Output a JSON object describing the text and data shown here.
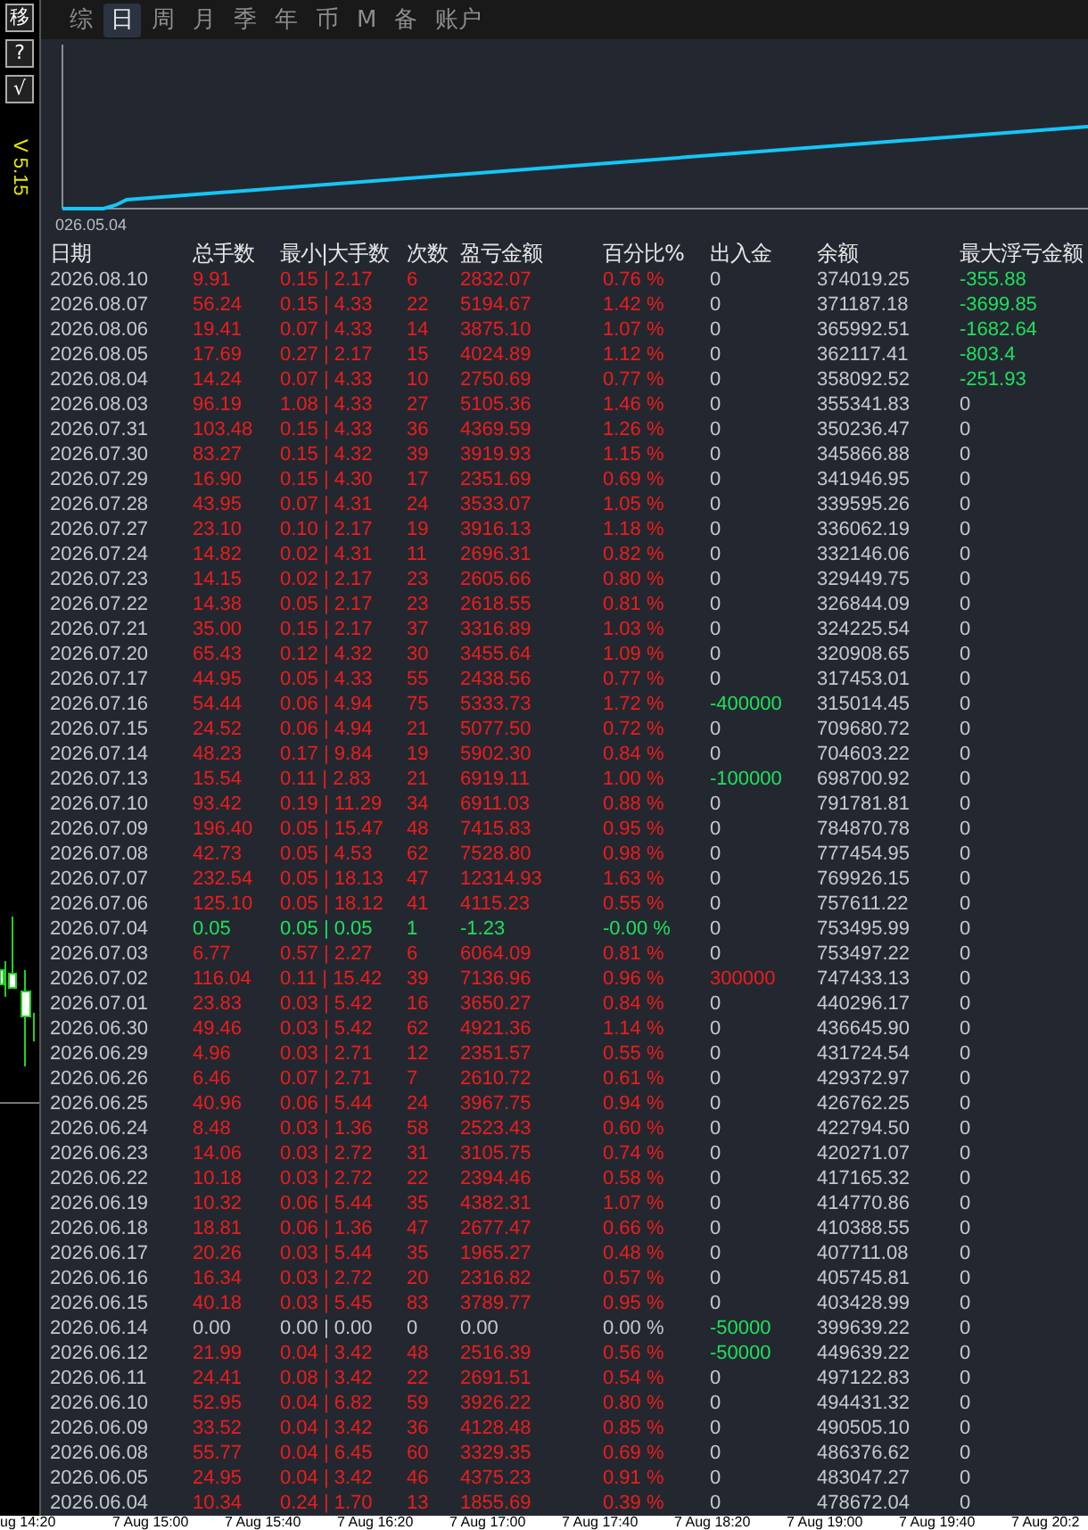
{
  "side_buttons": [
    "移",
    "?",
    "√"
  ],
  "version": "V 5.15",
  "tabs": [
    {
      "label": "综",
      "selected": false
    },
    {
      "label": "日",
      "selected": true
    },
    {
      "label": "周",
      "selected": false
    },
    {
      "label": "月",
      "selected": false
    },
    {
      "label": "季",
      "selected": false
    },
    {
      "label": "年",
      "selected": false
    },
    {
      "label": "币",
      "selected": false
    },
    {
      "label": "M",
      "selected": false
    },
    {
      "label": "备",
      "selected": false
    },
    {
      "label": "账户",
      "selected": false
    }
  ],
  "chart": {
    "start_label": "026.05.04"
  },
  "table": {
    "columns": [
      "日期",
      "总手数",
      "最小|大手数",
      "次数",
      "盈亏金额",
      "百分比%",
      "出入金",
      "余额",
      "最大浮亏金额"
    ],
    "rows": [
      {
        "date": "2026.08.10",
        "lots": "9.91",
        "range": "0.15 | 2.17",
        "trades": "6",
        "profit": "2832.07",
        "percent": "0.76 %",
        "cash": {
          "text": "0",
          "kind": "none"
        },
        "balance": "374019.25",
        "drawdown": {
          "text": "-355.88",
          "kind": "loss"
        },
        "kind": "gain"
      },
      {
        "date": "2026.08.07",
        "lots": "56.24",
        "range": "0.15 | 4.33",
        "trades": "22",
        "profit": "5194.67",
        "percent": "1.42 %",
        "cash": {
          "text": "0",
          "kind": "none"
        },
        "balance": "371187.18",
        "drawdown": {
          "text": "-3699.85",
          "kind": "loss"
        },
        "kind": "gain"
      },
      {
        "date": "2026.08.06",
        "lots": "19.41",
        "range": "0.07 | 4.33",
        "trades": "14",
        "profit": "3875.10",
        "percent": "1.07 %",
        "cash": {
          "text": "0",
          "kind": "none"
        },
        "balance": "365992.51",
        "drawdown": {
          "text": "-1682.64",
          "kind": "loss"
        },
        "kind": "gain"
      },
      {
        "date": "2026.08.05",
        "lots": "17.69",
        "range": "0.27 | 2.17",
        "trades": "15",
        "profit": "4024.89",
        "percent": "1.12 %",
        "cash": {
          "text": "0",
          "kind": "none"
        },
        "balance": "362117.41",
        "drawdown": {
          "text": "-803.4",
          "kind": "loss"
        },
        "kind": "gain"
      },
      {
        "date": "2026.08.04",
        "lots": "14.24",
        "range": "0.07 | 4.33",
        "trades": "10",
        "profit": "2750.69",
        "percent": "0.77 %",
        "cash": {
          "text": "0",
          "kind": "none"
        },
        "balance": "358092.52",
        "drawdown": {
          "text": "-251.93",
          "kind": "loss"
        },
        "kind": "gain"
      },
      {
        "date": "2026.08.03",
        "lots": "96.19",
        "range": "1.08 | 4.33",
        "trades": "27",
        "profit": "5105.36",
        "percent": "1.46 %",
        "cash": {
          "text": "0",
          "kind": "none"
        },
        "balance": "355341.83",
        "drawdown": {
          "text": "0",
          "kind": "none"
        },
        "kind": "gain"
      },
      {
        "date": "2026.07.31",
        "lots": "103.48",
        "range": "0.15 | 4.33",
        "trades": "36",
        "profit": "4369.59",
        "percent": "1.26 %",
        "cash": {
          "text": "0",
          "kind": "none"
        },
        "balance": "350236.47",
        "drawdown": {
          "text": "0",
          "kind": "none"
        },
        "kind": "gain"
      },
      {
        "date": "2026.07.30",
        "lots": "83.27",
        "range": "0.15 | 4.32",
        "trades": "39",
        "profit": "3919.93",
        "percent": "1.15 %",
        "cash": {
          "text": "0",
          "kind": "none"
        },
        "balance": "345866.88",
        "drawdown": {
          "text": "0",
          "kind": "none"
        },
        "kind": "gain"
      },
      {
        "date": "2026.07.29",
        "lots": "16.90",
        "range": "0.15 | 4.30",
        "trades": "17",
        "profit": "2351.69",
        "percent": "0.69 %",
        "cash": {
          "text": "0",
          "kind": "none"
        },
        "balance": "341946.95",
        "drawdown": {
          "text": "0",
          "kind": "none"
        },
        "kind": "gain"
      },
      {
        "date": "2026.07.28",
        "lots": "43.95",
        "range": "0.07 | 4.31",
        "trades": "24",
        "profit": "3533.07",
        "percent": "1.05 %",
        "cash": {
          "text": "0",
          "kind": "none"
        },
        "balance": "339595.26",
        "drawdown": {
          "text": "0",
          "kind": "none"
        },
        "kind": "gain"
      },
      {
        "date": "2026.07.27",
        "lots": "23.10",
        "range": "0.10 | 2.17",
        "trades": "19",
        "profit": "3916.13",
        "percent": "1.18 %",
        "cash": {
          "text": "0",
          "kind": "none"
        },
        "balance": "336062.19",
        "drawdown": {
          "text": "0",
          "kind": "none"
        },
        "kind": "gain"
      },
      {
        "date": "2026.07.24",
        "lots": "14.82",
        "range": "0.02 | 4.31",
        "trades": "11",
        "profit": "2696.31",
        "percent": "0.82 %",
        "cash": {
          "text": "0",
          "kind": "none"
        },
        "balance": "332146.06",
        "drawdown": {
          "text": "0",
          "kind": "none"
        },
        "kind": "gain"
      },
      {
        "date": "2026.07.23",
        "lots": "14.15",
        "range": "0.02 | 2.17",
        "trades": "23",
        "profit": "2605.66",
        "percent": "0.80 %",
        "cash": {
          "text": "0",
          "kind": "none"
        },
        "balance": "329449.75",
        "drawdown": {
          "text": "0",
          "kind": "none"
        },
        "kind": "gain"
      },
      {
        "date": "2026.07.22",
        "lots": "14.38",
        "range": "0.05 | 2.17",
        "trades": "23",
        "profit": "2618.55",
        "percent": "0.81 %",
        "cash": {
          "text": "0",
          "kind": "none"
        },
        "balance": "326844.09",
        "drawdown": {
          "text": "0",
          "kind": "none"
        },
        "kind": "gain"
      },
      {
        "date": "2026.07.21",
        "lots": "35.00",
        "range": "0.15 | 2.17",
        "trades": "37",
        "profit": "3316.89",
        "percent": "1.03 %",
        "cash": {
          "text": "0",
          "kind": "none"
        },
        "balance": "324225.54",
        "drawdown": {
          "text": "0",
          "kind": "none"
        },
        "kind": "gain"
      },
      {
        "date": "2026.07.20",
        "lots": "65.43",
        "range": "0.12 | 4.32",
        "trades": "30",
        "profit": "3455.64",
        "percent": "1.09 %",
        "cash": {
          "text": "0",
          "kind": "none"
        },
        "balance": "320908.65",
        "drawdown": {
          "text": "0",
          "kind": "none"
        },
        "kind": "gain"
      },
      {
        "date": "2026.07.17",
        "lots": "44.95",
        "range": "0.05 | 4.33",
        "trades": "55",
        "profit": "2438.56",
        "percent": "0.77 %",
        "cash": {
          "text": "0",
          "kind": "none"
        },
        "balance": "317453.01",
        "drawdown": {
          "text": "0",
          "kind": "none"
        },
        "kind": "gain"
      },
      {
        "date": "2026.07.16",
        "lots": "54.44",
        "range": "0.06 | 4.94",
        "trades": "75",
        "profit": "5333.73",
        "percent": "1.72 %",
        "cash": {
          "text": "-400000",
          "kind": "out"
        },
        "balance": "315014.45",
        "drawdown": {
          "text": "0",
          "kind": "none"
        },
        "kind": "gain"
      },
      {
        "date": "2026.07.15",
        "lots": "24.52",
        "range": "0.06 | 4.94",
        "trades": "21",
        "profit": "5077.50",
        "percent": "0.72 %",
        "cash": {
          "text": "0",
          "kind": "none"
        },
        "balance": "709680.72",
        "drawdown": {
          "text": "0",
          "kind": "none"
        },
        "kind": "gain"
      },
      {
        "date": "2026.07.14",
        "lots": "48.23",
        "range": "0.17 | 9.84",
        "trades": "19",
        "profit": "5902.30",
        "percent": "0.84 %",
        "cash": {
          "text": "0",
          "kind": "none"
        },
        "balance": "704603.22",
        "drawdown": {
          "text": "0",
          "kind": "none"
        },
        "kind": "gain"
      },
      {
        "date": "2026.07.13",
        "lots": "15.54",
        "range": "0.11 | 2.83",
        "trades": "21",
        "profit": "6919.11",
        "percent": "1.00 %",
        "cash": {
          "text": "-100000",
          "kind": "out"
        },
        "balance": "698700.92",
        "drawdown": {
          "text": "0",
          "kind": "none"
        },
        "kind": "gain"
      },
      {
        "date": "2026.07.10",
        "lots": "93.42",
        "range": "0.19 | 11.29",
        "trades": "34",
        "profit": "6911.03",
        "percent": "0.88 %",
        "cash": {
          "text": "0",
          "kind": "none"
        },
        "balance": "791781.81",
        "drawdown": {
          "text": "0",
          "kind": "none"
        },
        "kind": "gain"
      },
      {
        "date": "2026.07.09",
        "lots": "196.40",
        "range": "0.05 | 15.47",
        "trades": "48",
        "profit": "7415.83",
        "percent": "0.95 %",
        "cash": {
          "text": "0",
          "kind": "none"
        },
        "balance": "784870.78",
        "drawdown": {
          "text": "0",
          "kind": "none"
        },
        "kind": "gain"
      },
      {
        "date": "2026.07.08",
        "lots": "42.73",
        "range": "0.05 | 4.53",
        "trades": "62",
        "profit": "7528.80",
        "percent": "0.98 %",
        "cash": {
          "text": "0",
          "kind": "none"
        },
        "balance": "777454.95",
        "drawdown": {
          "text": "0",
          "kind": "none"
        },
        "kind": "gain"
      },
      {
        "date": "2026.07.07",
        "lots": "232.54",
        "range": "0.05 | 18.13",
        "trades": "47",
        "profit": "12314.93",
        "percent": "1.63 %",
        "cash": {
          "text": "0",
          "kind": "none"
        },
        "balance": "769926.15",
        "drawdown": {
          "text": "0",
          "kind": "none"
        },
        "kind": "gain"
      },
      {
        "date": "2026.07.06",
        "lots": "125.10",
        "range": "0.05 | 18.12",
        "trades": "41",
        "profit": "4115.23",
        "percent": "0.55 %",
        "cash": {
          "text": "0",
          "kind": "none"
        },
        "balance": "757611.22",
        "drawdown": {
          "text": "0",
          "kind": "none"
        },
        "kind": "gain"
      },
      {
        "date": "2026.07.04",
        "lots": "0.05",
        "range": "0.05 | 0.05",
        "trades": "1",
        "profit": "-1.23",
        "percent": "-0.00 %",
        "cash": {
          "text": "0",
          "kind": "none"
        },
        "balance": "753495.99",
        "drawdown": {
          "text": "0",
          "kind": "none"
        },
        "kind": "loss"
      },
      {
        "date": "2026.07.03",
        "lots": "6.77",
        "range": "0.57 | 2.27",
        "trades": "6",
        "profit": "6064.09",
        "percent": "0.81 %",
        "cash": {
          "text": "0",
          "kind": "none"
        },
        "balance": "753497.22",
        "drawdown": {
          "text": "0",
          "kind": "none"
        },
        "kind": "gain"
      },
      {
        "date": "2026.07.02",
        "lots": "116.04",
        "range": "0.11 | 15.42",
        "trades": "39",
        "profit": "7136.96",
        "percent": "0.96 %",
        "cash": {
          "text": "300000",
          "kind": "in"
        },
        "balance": "747433.13",
        "drawdown": {
          "text": "0",
          "kind": "none"
        },
        "kind": "gain"
      },
      {
        "date": "2026.07.01",
        "lots": "23.83",
        "range": "0.03 | 5.42",
        "trades": "16",
        "profit": "3650.27",
        "percent": "0.84 %",
        "cash": {
          "text": "0",
          "kind": "none"
        },
        "balance": "440296.17",
        "drawdown": {
          "text": "0",
          "kind": "none"
        },
        "kind": "gain"
      },
      {
        "date": "2026.06.30",
        "lots": "49.46",
        "range": "0.03 | 5.42",
        "trades": "62",
        "profit": "4921.36",
        "percent": "1.14 %",
        "cash": {
          "text": "0",
          "kind": "none"
        },
        "balance": "436645.90",
        "drawdown": {
          "text": "0",
          "kind": "none"
        },
        "kind": "gain"
      },
      {
        "date": "2026.06.29",
        "lots": "4.96",
        "range": "0.03 | 2.71",
        "trades": "12",
        "profit": "2351.57",
        "percent": "0.55 %",
        "cash": {
          "text": "0",
          "kind": "none"
        },
        "balance": "431724.54",
        "drawdown": {
          "text": "0",
          "kind": "none"
        },
        "kind": "gain"
      },
      {
        "date": "2026.06.26",
        "lots": "6.46",
        "range": "0.07 | 2.71",
        "trades": "7",
        "profit": "2610.72",
        "percent": "0.61 %",
        "cash": {
          "text": "0",
          "kind": "none"
        },
        "balance": "429372.97",
        "drawdown": {
          "text": "0",
          "kind": "none"
        },
        "kind": "gain"
      },
      {
        "date": "2026.06.25",
        "lots": "40.96",
        "range": "0.06 | 5.44",
        "trades": "24",
        "profit": "3967.75",
        "percent": "0.94 %",
        "cash": {
          "text": "0",
          "kind": "none"
        },
        "balance": "426762.25",
        "drawdown": {
          "text": "0",
          "kind": "none"
        },
        "kind": "gain"
      },
      {
        "date": "2026.06.24",
        "lots": "8.48",
        "range": "0.03 | 1.36",
        "trades": "58",
        "profit": "2523.43",
        "percent": "0.60 %",
        "cash": {
          "text": "0",
          "kind": "none"
        },
        "balance": "422794.50",
        "drawdown": {
          "text": "0",
          "kind": "none"
        },
        "kind": "gain"
      },
      {
        "date": "2026.06.23",
        "lots": "14.06",
        "range": "0.03 | 2.72",
        "trades": "31",
        "profit": "3105.75",
        "percent": "0.74 %",
        "cash": {
          "text": "0",
          "kind": "none"
        },
        "balance": "420271.07",
        "drawdown": {
          "text": "0",
          "kind": "none"
        },
        "kind": "gain"
      },
      {
        "date": "2026.06.22",
        "lots": "10.18",
        "range": "0.03 | 2.72",
        "trades": "22",
        "profit": "2394.46",
        "percent": "0.58 %",
        "cash": {
          "text": "0",
          "kind": "none"
        },
        "balance": "417165.32",
        "drawdown": {
          "text": "0",
          "kind": "none"
        },
        "kind": "gain"
      },
      {
        "date": "2026.06.19",
        "lots": "10.32",
        "range": "0.06 | 5.44",
        "trades": "35",
        "profit": "4382.31",
        "percent": "1.07 %",
        "cash": {
          "text": "0",
          "kind": "none"
        },
        "balance": "414770.86",
        "drawdown": {
          "text": "0",
          "kind": "none"
        },
        "kind": "gain"
      },
      {
        "date": "2026.06.18",
        "lots": "18.81",
        "range": "0.06 | 1.36",
        "trades": "47",
        "profit": "2677.47",
        "percent": "0.66 %",
        "cash": {
          "text": "0",
          "kind": "none"
        },
        "balance": "410388.55",
        "drawdown": {
          "text": "0",
          "kind": "none"
        },
        "kind": "gain"
      },
      {
        "date": "2026.06.17",
        "lots": "20.26",
        "range": "0.03 | 5.44",
        "trades": "35",
        "profit": "1965.27",
        "percent": "0.48 %",
        "cash": {
          "text": "0",
          "kind": "none"
        },
        "balance": "407711.08",
        "drawdown": {
          "text": "0",
          "kind": "none"
        },
        "kind": "gain"
      },
      {
        "date": "2026.06.16",
        "lots": "16.34",
        "range": "0.03 | 2.72",
        "trades": "20",
        "profit": "2316.82",
        "percent": "0.57 %",
        "cash": {
          "text": "0",
          "kind": "none"
        },
        "balance": "405745.81",
        "drawdown": {
          "text": "0",
          "kind": "none"
        },
        "kind": "gain"
      },
      {
        "date": "2026.06.15",
        "lots": "40.18",
        "range": "0.03 | 5.45",
        "trades": "83",
        "profit": "3789.77",
        "percent": "0.95 %",
        "cash": {
          "text": "0",
          "kind": "none"
        },
        "balance": "403428.99",
        "drawdown": {
          "text": "0",
          "kind": "none"
        },
        "kind": "gain"
      },
      {
        "date": "2026.06.14",
        "lots": "0.00",
        "range": "0.00 | 0.00",
        "trades": "0",
        "profit": "0.00",
        "percent": "0.00 %",
        "cash": {
          "text": "-50000",
          "kind": "out"
        },
        "balance": "399639.22",
        "drawdown": {
          "text": "0",
          "kind": "none"
        },
        "kind": "flat"
      },
      {
        "date": "2026.06.12",
        "lots": "21.99",
        "range": "0.04 | 3.42",
        "trades": "48",
        "profit": "2516.39",
        "percent": "0.56 %",
        "cash": {
          "text": "-50000",
          "kind": "out"
        },
        "balance": "449639.22",
        "drawdown": {
          "text": "0",
          "kind": "none"
        },
        "kind": "gain"
      },
      {
        "date": "2026.06.11",
        "lots": "24.41",
        "range": "0.08 | 3.42",
        "trades": "22",
        "profit": "2691.51",
        "percent": "0.54 %",
        "cash": {
          "text": "0",
          "kind": "none"
        },
        "balance": "497122.83",
        "drawdown": {
          "text": "0",
          "kind": "none"
        },
        "kind": "gain"
      },
      {
        "date": "2026.06.10",
        "lots": "52.95",
        "range": "0.04 | 6.82",
        "trades": "59",
        "profit": "3926.22",
        "percent": "0.80 %",
        "cash": {
          "text": "0",
          "kind": "none"
        },
        "balance": "494431.32",
        "drawdown": {
          "text": "0",
          "kind": "none"
        },
        "kind": "gain"
      },
      {
        "date": "2026.06.09",
        "lots": "33.52",
        "range": "0.04 | 3.42",
        "trades": "36",
        "profit": "4128.48",
        "percent": "0.85 %",
        "cash": {
          "text": "0",
          "kind": "none"
        },
        "balance": "490505.10",
        "drawdown": {
          "text": "0",
          "kind": "none"
        },
        "kind": "gain"
      },
      {
        "date": "2026.06.08",
        "lots": "55.77",
        "range": "0.04 | 6.45",
        "trades": "60",
        "profit": "3329.35",
        "percent": "0.69 %",
        "cash": {
          "text": "0",
          "kind": "none"
        },
        "balance": "486376.62",
        "drawdown": {
          "text": "0",
          "kind": "none"
        },
        "kind": "gain"
      },
      {
        "date": "2026.06.05",
        "lots": "24.95",
        "range": "0.04 | 3.42",
        "trades": "46",
        "profit": "4375.23",
        "percent": "0.91 %",
        "cash": {
          "text": "0",
          "kind": "none"
        },
        "balance": "483047.27",
        "drawdown": {
          "text": "0",
          "kind": "none"
        },
        "kind": "gain"
      },
      {
        "date": "2026.06.04",
        "lots": "10.34",
        "range": "0.24 | 1.70",
        "trades": "13",
        "profit": "1855.69",
        "percent": "0.39 %",
        "cash": {
          "text": "0",
          "kind": "none"
        },
        "balance": "478672.04",
        "drawdown": {
          "text": "0",
          "kind": "none"
        },
        "kind": "gain"
      }
    ]
  },
  "time_axis": [
    "ug 14:20",
    "7 Aug 15:00",
    "7 Aug 15:40",
    "7 Aug 16:20",
    "7 Aug 17:00",
    "7 Aug 17:40",
    "7 Aug 18:20",
    "7 Aug 19:00",
    "7 Aug 19:40",
    "7 Aug 20:2"
  ]
}
